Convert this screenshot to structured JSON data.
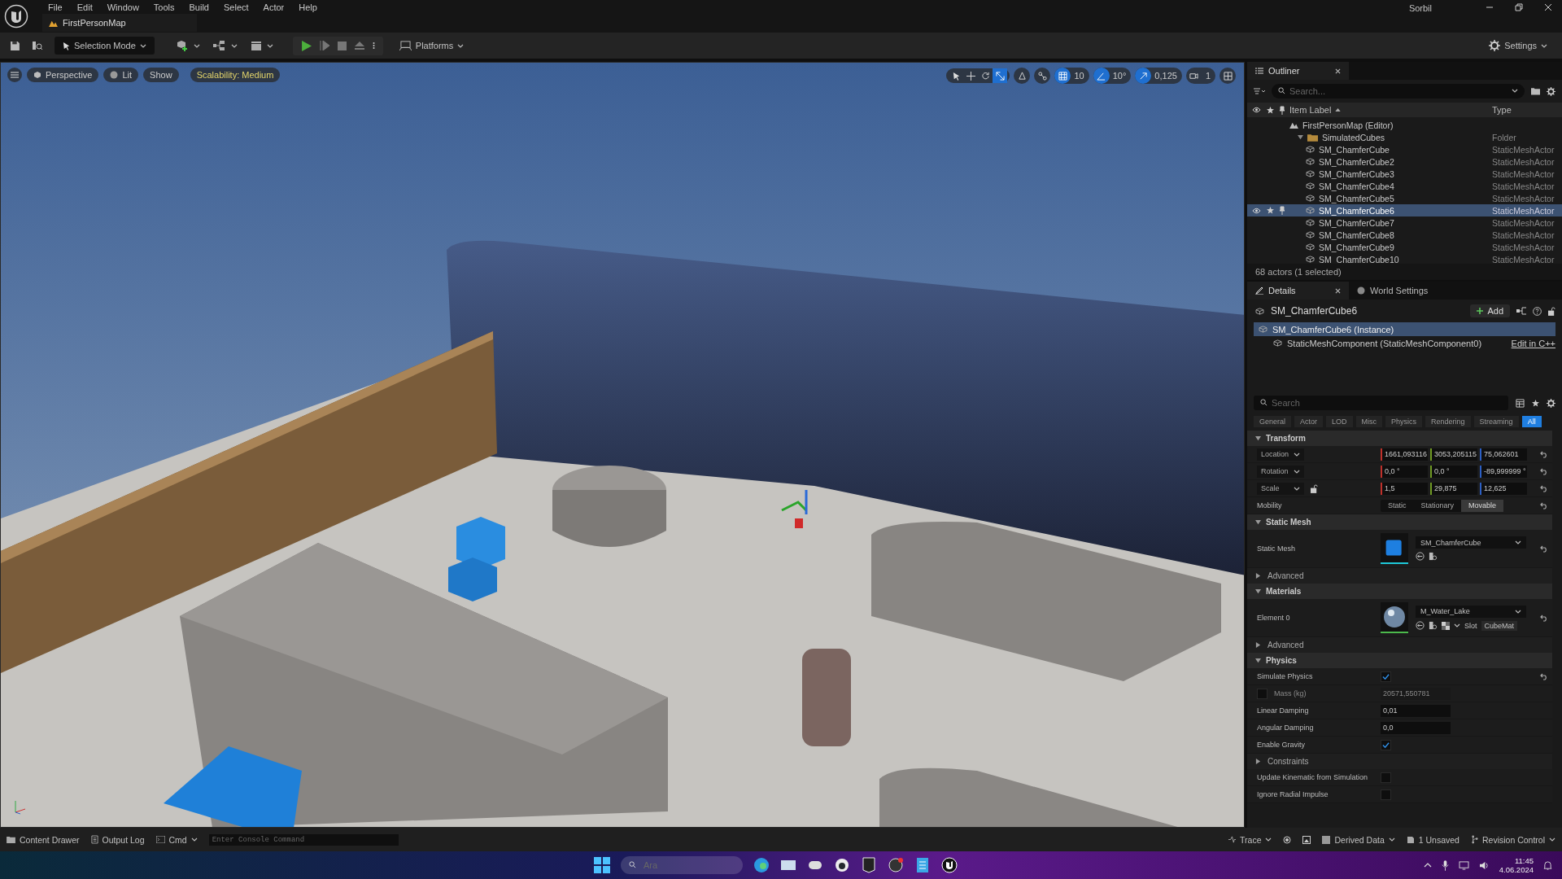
{
  "menu": [
    "File",
    "Edit",
    "Window",
    "Tools",
    "Build",
    "Select",
    "Actor",
    "Help"
  ],
  "user": "Sorbil",
  "level_tab": "FirstPersonMap",
  "toolbar": {
    "selection_mode": "Selection Mode",
    "platforms": "Platforms",
    "settings": "Settings"
  },
  "viewport": {
    "buttons": [
      "Perspective",
      "Lit",
      "Show"
    ],
    "scalability": "Scalability: Medium",
    "transform_tools": [
      {
        "kind": "select",
        "selected": false
      },
      {
        "kind": "translate",
        "selected": false
      },
      {
        "kind": "rotate",
        "selected": false
      },
      {
        "kind": "scale",
        "selected": true
      }
    ],
    "snaps": [
      {
        "kind": "grid",
        "value": "10",
        "on": true
      },
      {
        "kind": "rotation",
        "value": "10°",
        "on": true
      },
      {
        "kind": "scale",
        "value": "0,125",
        "on": true
      },
      {
        "kind": "camera",
        "value": "1",
        "on": false
      }
    ]
  },
  "outliner": {
    "title": "Outliner",
    "search_placeholder": "Search...",
    "columns": [
      "Item Label",
      "Type"
    ],
    "tree": [
      {
        "label": "FirstPersonMap (Editor)",
        "kind": "map",
        "selected": false,
        "children": [
          {
            "label": "SimulatedCubes",
            "type": "Folder",
            "kind": "folder",
            "expanded": true,
            "selected": false,
            "children": [
              {
                "label": "SM_ChamferCube",
                "type": "StaticMeshActor",
                "kind": "actor",
                "selected": false
              },
              {
                "label": "SM_ChamferCube2",
                "type": "StaticMeshActor",
                "kind": "actor",
                "selected": false
              },
              {
                "label": "SM_ChamferCube3",
                "type": "StaticMeshActor",
                "kind": "actor",
                "selected": false
              },
              {
                "label": "SM_ChamferCube4",
                "type": "StaticMeshActor",
                "kind": "actor",
                "selected": false
              },
              {
                "label": "SM_ChamferCube5",
                "type": "StaticMeshActor",
                "kind": "actor",
                "selected": false
              },
              {
                "label": "SM_ChamferCube6",
                "type": "StaticMeshActor",
                "kind": "actor",
                "selected": true
              },
              {
                "label": "SM_ChamferCube7",
                "type": "StaticMeshActor",
                "kind": "actor",
                "selected": false
              },
              {
                "label": "SM_ChamferCube8",
                "type": "StaticMeshActor",
                "kind": "actor",
                "selected": false
              },
              {
                "label": "SM_ChamferCube9",
                "type": "StaticMeshActor",
                "kind": "actor",
                "selected": false
              },
              {
                "label": "SM_ChamferCube10",
                "type": "StaticMeshActor",
                "kind": "actor",
                "selected": false
              }
            ]
          }
        ]
      }
    ],
    "status": "68 actors (1 selected)"
  },
  "details": {
    "tabs": [
      {
        "label": "Details",
        "selected": true
      },
      {
        "label": "World Settings",
        "selected": false
      }
    ],
    "actor": "SM_ChamferCube6",
    "add": "Add",
    "components": [
      {
        "label": "SM_ChamferCube6 (Instance)",
        "selected": true
      },
      {
        "label": "StaticMeshComponent (StaticMeshComponent0)",
        "selected": false
      }
    ],
    "edit_link": "Edit in C++",
    "search_placeholder": "Search",
    "filters": [
      {
        "label": "General",
        "selected": false
      },
      {
        "label": "Actor",
        "selected": false
      },
      {
        "label": "LOD",
        "selected": false
      },
      {
        "label": "Misc",
        "selected": false
      },
      {
        "label": "Physics",
        "selected": false
      },
      {
        "label": "Rendering",
        "selected": false
      },
      {
        "label": "Streaming",
        "selected": false
      },
      {
        "label": "All",
        "selected": true
      }
    ],
    "rows": [
      {
        "kind": "header",
        "title": "Transform",
        "expanded": true
      },
      {
        "kind": "vector",
        "label": "Location",
        "values": [
          "1661,093116",
          "3053,205115",
          "75,062601"
        ],
        "reset": true
      },
      {
        "kind": "vector",
        "label": "Rotation",
        "values": [
          "0,0 °",
          "0,0 °",
          "-89,999999 °"
        ],
        "reset": true
      },
      {
        "kind": "vector",
        "label": "Scale",
        "values": [
          "1,5",
          "29,875",
          "12,625"
        ],
        "reset": true,
        "locked": false
      },
      {
        "kind": "mobility",
        "label": "Mobility",
        "options": [
          {
            "label": "Static",
            "selected": false
          },
          {
            "label": "Stationary",
            "selected": false
          },
          {
            "label": "Movable",
            "selected": true
          }
        ],
        "reset": true
      },
      {
        "kind": "header",
        "title": "Static Mesh",
        "expanded": true
      },
      {
        "kind": "mesh",
        "label": "Static Mesh",
        "value": "SM_ChamferCube",
        "reset": true
      },
      {
        "kind": "subheader",
        "title": "Advanced",
        "expanded": false
      },
      {
        "kind": "header",
        "title": "Materials",
        "expanded": true
      },
      {
        "kind": "material",
        "label": "Element 0",
        "value": "M_Water_Lake",
        "slot_label": "Slot",
        "slot": "CubeMat",
        "reset": true
      },
      {
        "kind": "subheader",
        "title": "Advanced",
        "expanded": false
      },
      {
        "kind": "header",
        "title": "Physics",
        "expanded": true
      },
      {
        "kind": "checkbox",
        "label": "Simulate Physics",
        "checked": true,
        "reset": true
      },
      {
        "kind": "mass",
        "label": "Mass (kg)",
        "value": "20571,550781",
        "checked": false,
        "disabled": true
      },
      {
        "kind": "number",
        "label": "Linear Damping",
        "value": "0,01"
      },
      {
        "kind": "number",
        "label": "Angular Damping",
        "value": "0,0"
      },
      {
        "kind": "checkbox",
        "label": "Enable Gravity",
        "checked": true,
        "reset": false
      },
      {
        "kind": "subheader",
        "title": "Constraints",
        "expanded": false
      },
      {
        "kind": "checkbox",
        "label": "Update Kinematic from Simulation",
        "checked": false,
        "reset": false
      },
      {
        "kind": "checkbox",
        "label": "Ignore Radial Impulse",
        "checked": false,
        "reset": false
      }
    ]
  },
  "status_bar": {
    "left": [
      "Content Drawer",
      "Output Log",
      "Cmd"
    ],
    "console_placeholder": "Enter Console Command",
    "trace": "Trace",
    "derived_data": "Derived Data",
    "unsaved": "1 Unsaved",
    "revision": "Revision Control"
  },
  "taskbar": {
    "search_placeholder": "Ara",
    "time": "11:45",
    "date": "4.06.2024"
  }
}
